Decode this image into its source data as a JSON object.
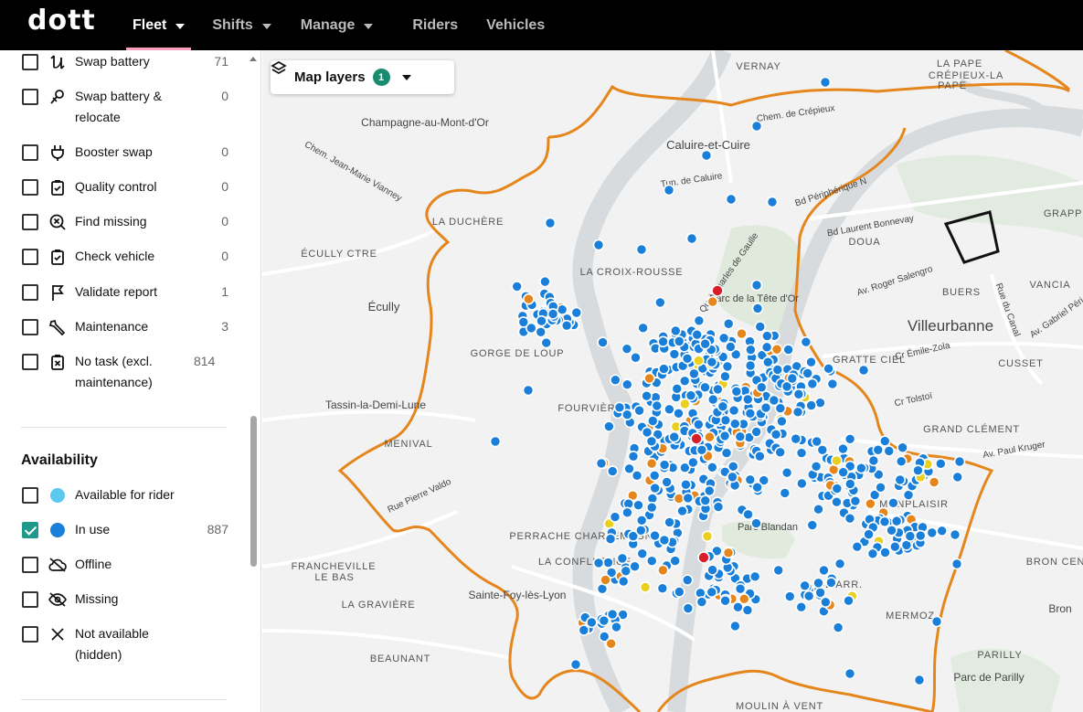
{
  "app": {
    "logo": "dott"
  },
  "nav": [
    {
      "label": "Fleet",
      "active": true,
      "dropdown": true
    },
    {
      "label": "Shifts",
      "active": false,
      "dropdown": true
    },
    {
      "label": "Manage",
      "active": false,
      "dropdown": true
    },
    {
      "label": "Riders",
      "active": false,
      "dropdown": false
    },
    {
      "label": "Vehicles",
      "active": false,
      "dropdown": false
    }
  ],
  "tasks": [
    {
      "label": "Swap battery",
      "count": "71",
      "icon": "swap-battery-icon",
      "checked": false
    },
    {
      "label": "Swap battery & relocate",
      "count": "0",
      "icon": "relocate-icon",
      "checked": false
    },
    {
      "label": "Booster swap",
      "count": "0",
      "icon": "plug-icon",
      "checked": false
    },
    {
      "label": "Quality control",
      "count": "0",
      "icon": "clipboard-check-icon",
      "checked": false
    },
    {
      "label": "Find missing",
      "count": "0",
      "icon": "search-x-icon",
      "checked": false
    },
    {
      "label": "Check vehicle",
      "count": "0",
      "icon": "clipboard-check-icon",
      "checked": false
    },
    {
      "label": "Validate report",
      "count": "1",
      "icon": "flag-icon",
      "checked": false
    },
    {
      "label": "Maintenance",
      "count": "3",
      "icon": "wrench-icon",
      "checked": false
    },
    {
      "label": "No task (excl. maintenance)",
      "count": "814",
      "icon": "clipboard-x-icon",
      "checked": false
    }
  ],
  "availability": {
    "title": "Availability",
    "items": [
      {
        "label": "Available for rider",
        "count": "",
        "icon": "light-blue-dot-icon",
        "color": "#5bc8f0",
        "checked": false
      },
      {
        "label": "In use",
        "count": "887",
        "icon": "blue-dot-icon",
        "color": "#1a7fd8",
        "checked": true
      },
      {
        "label": "Offline",
        "count": "",
        "icon": "cloud-off-icon",
        "checked": false
      },
      {
        "label": "Missing",
        "count": "",
        "icon": "eye-off-icon",
        "checked": false
      },
      {
        "label": "Not available (hidden)",
        "count": "",
        "icon": "x-icon",
        "checked": false
      }
    ]
  },
  "map": {
    "layers_label": "Map layers",
    "layers_badge": "1",
    "colors": {
      "zone": "#e5861d",
      "vehicle": "#1a7fd8",
      "warn": "#e5861d",
      "yellow": "#e9cf1e",
      "alert": "#d81e2a"
    },
    "places": [
      "VERNAY",
      "LA PAPE",
      "CRÉPIEUX-LA",
      "PAPE",
      "Champagne-au-Mont-d'Or",
      "Chem. de Crépieux",
      "Caluire-et-Cuire",
      "Tun. de Caluire",
      "Bd Périphérique N",
      "LA DUCHÈRE",
      "Bd Laurent Bonnevay",
      "DOUA",
      "GRAPPI",
      "ÉCULLY CTRE",
      "LA CROIX-ROUSSE",
      "Écully",
      "BUERS",
      "VANCIA",
      "Villeurbanne",
      "GRATTE CIEL",
      "CUSSET",
      "Tassin-la-Demi-Lune",
      "FOURVIÈRE",
      "GRAND CLÉMENT",
      "MENIVAL",
      "Av. Paul Kruger",
      "MONPLAISIR",
      "LA CONFLUENCE",
      "FRANCHEVILLE",
      "LE BAS",
      "BRON CEN",
      "Sainte-Foy-lès-Lyon",
      "8E ARR.",
      "LA GRAVIÈRE",
      "Bron",
      "MERMOZ",
      "BEAUNANT",
      "PARILLY",
      "Parc de Parilly",
      "MOULIN À VENT",
      "Av. Roger Salengro",
      "Cr Émile-Zola",
      "Cr Tolstoï",
      "Rue Pierre Valdo",
      "GORGE DE LOUP",
      "Parc de la Tête d'Or",
      "Parc Blandan",
      "Chem. Jean-Marie Vianney",
      "Quai Charles de Gaulle",
      "PERRACHE CHARLEMAGNE",
      "Av. Gabriel Péri",
      "Rue du Canal"
    ]
  }
}
